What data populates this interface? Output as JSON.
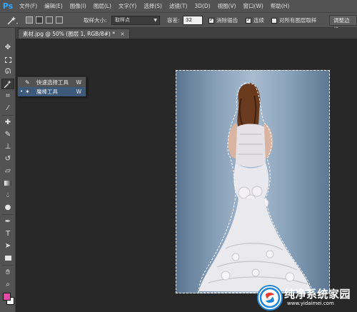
{
  "app": {
    "logo": "Ps"
  },
  "menu": [
    "文件(F)",
    "编辑(E)",
    "图像(I)",
    "图层(L)",
    "文字(Y)",
    "选择(S)",
    "滤镜(T)",
    "3D(D)",
    "视图(V)",
    "窗口(W)",
    "帮助(H)"
  ],
  "options": {
    "sample_size_label": "取样大小:",
    "sample_size_value": "取样点",
    "tolerance_label": "容差:",
    "tolerance_value": "32",
    "anti_alias_label": "消除锯齿",
    "anti_alias_checked": true,
    "contiguous_label": "连续",
    "contiguous_checked": true,
    "all_layers_label": "对所有图层取样",
    "all_layers_checked": false,
    "refine_edge_button": "调整边缘..."
  },
  "document": {
    "tab_title": "素材.jpg @ 50% (图层 1, RGB/8#) *",
    "close_glyph": "×"
  },
  "flyout": {
    "items": [
      {
        "label": "快速选择工具",
        "shortcut": "W",
        "icon": "quick-selection-icon"
      },
      {
        "label": "魔棒工具",
        "shortcut": "W",
        "icon": "magic-wand-icon",
        "selected": true
      }
    ]
  },
  "toolbar": {
    "tools": [
      "move-icon",
      "marquee-icon",
      "lasso-icon",
      "magic-wand-icon",
      "crop-icon",
      "eyedropper-icon",
      "healing-icon",
      "brush-icon",
      "stamp-icon",
      "history-brush-icon",
      "eraser-icon",
      "gradient-icon",
      "blur-icon",
      "dodge-icon",
      "pen-icon",
      "type-icon",
      "path-select-icon",
      "shape-icon",
      "hand-icon",
      "zoom-icon"
    ],
    "foreground_color": "#e64aa8",
    "background_color": "#ffffff"
  },
  "watermark": {
    "title": "纯净系统家园",
    "url": "www.yidaimei.com"
  }
}
